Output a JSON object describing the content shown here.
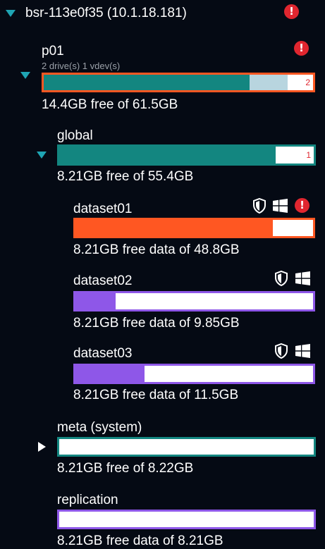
{
  "server": {
    "name": "bsr-113e0f35 (10.1.18.181)"
  },
  "pool": {
    "name": "p01",
    "details": "2 drive(s) 1 vdev(s)",
    "usage": "14.4GB free of 61.5GB",
    "used_fraction": 0.765,
    "reserved_fraction": 0.14,
    "alert_count": "2"
  },
  "global": {
    "name": "global",
    "usage": "8.21GB free of 55.4GB",
    "used_fraction": 0.85,
    "alert_count": "1"
  },
  "datasets": [
    {
      "name": "dataset01",
      "usage": "8.21GB free data of 48.8GB",
      "used_fraction": 0.83
    },
    {
      "name": "dataset02",
      "usage": "8.21GB free data of 9.85GB",
      "used_fraction": 0.17
    },
    {
      "name": "dataset03",
      "usage": "8.21GB free data of 11.5GB",
      "used_fraction": 0.29
    }
  ],
  "meta": {
    "name": "meta (system)",
    "usage": "8.21GB free of 8.22GB",
    "used_fraction": 0.0
  },
  "replication": {
    "name": "replication",
    "usage": "8.21GB free data of 8.21GB",
    "used_fraction": 0.0
  },
  "colors": {
    "background": "#050a14",
    "teal": "#138680",
    "teal_light": "#b8d5df",
    "orange": "#ff5722",
    "purple": "#8e57e8",
    "alert_red": "#e0262f",
    "expand_teal": "#1fa5b4"
  },
  "icons": {
    "alert": "!",
    "shield": "shield-icon",
    "windows": "windows-icon",
    "expand": "triangle-down-icon",
    "collapse": "triangle-right-icon"
  }
}
